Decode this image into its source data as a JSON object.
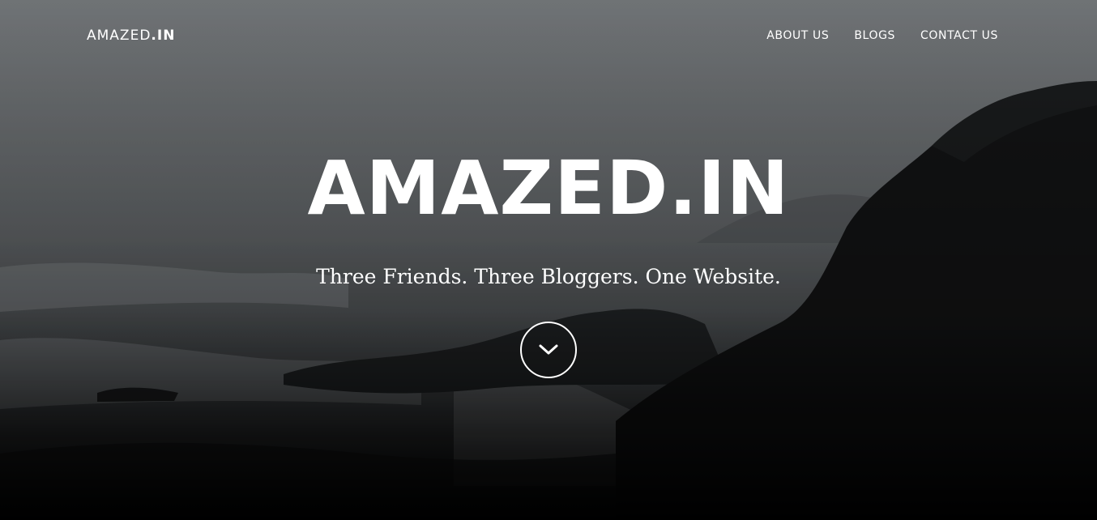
{
  "nav": {
    "brand_main": "AMAZED",
    "brand_bold": ".IN",
    "links": [
      {
        "label": "ABOUT US"
      },
      {
        "label": "BLOGS"
      },
      {
        "label": "CONTACT US"
      }
    ]
  },
  "hero": {
    "title": "AMAZED.IN",
    "subtitle": "Three Friends. Three Bloggers. One Website.",
    "scroll_icon": "chevron-down-icon"
  },
  "colors": {
    "text": "#ffffff",
    "overlay_top": "#7d8184",
    "overlay_bottom": "#050505"
  }
}
